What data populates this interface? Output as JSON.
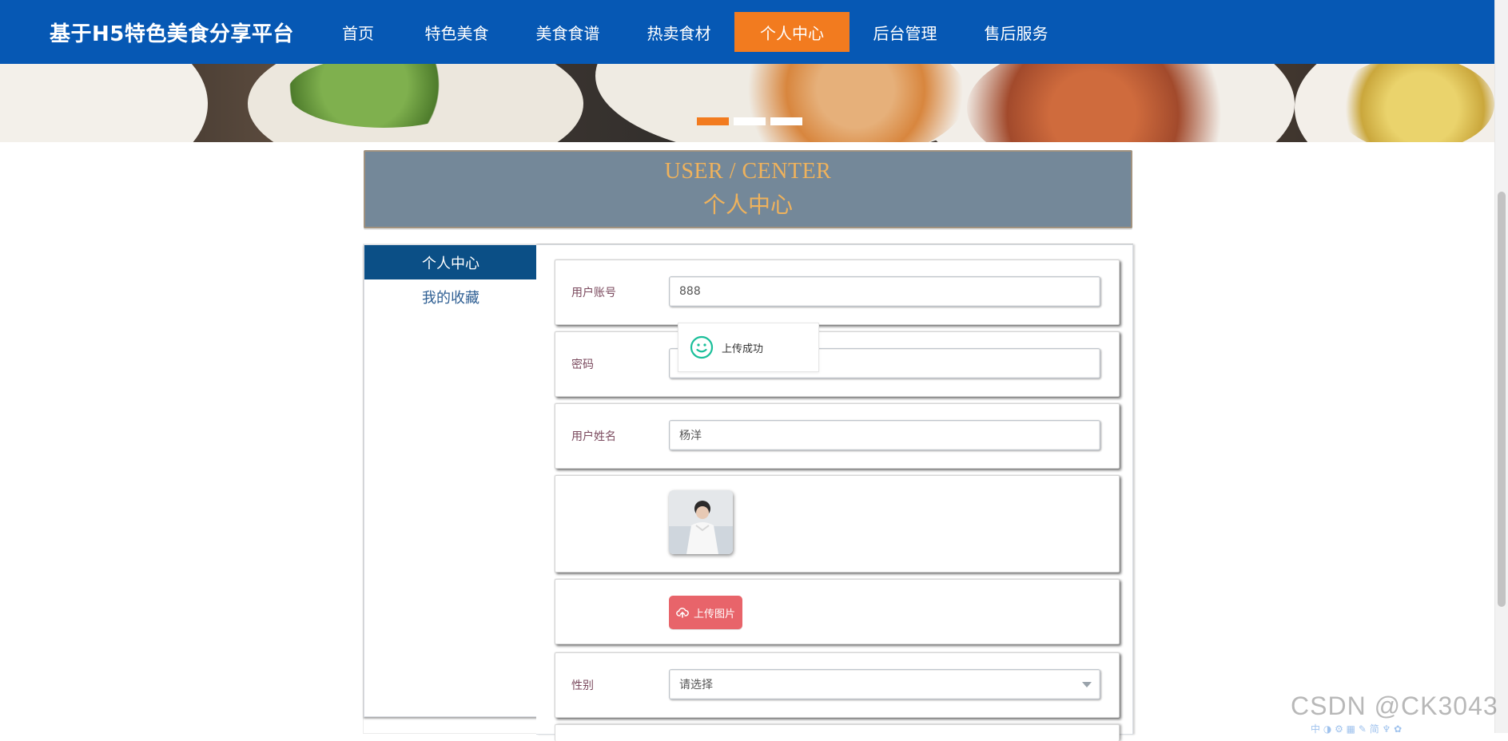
{
  "nav": {
    "brand": "基于H5特色美食分享平台",
    "items": [
      {
        "label": "首页",
        "active": false
      },
      {
        "label": "特色美食",
        "active": false
      },
      {
        "label": "美食食谱",
        "active": false
      },
      {
        "label": "热卖食材",
        "active": false
      },
      {
        "label": "个人中心",
        "active": true
      },
      {
        "label": "后台管理",
        "active": false
      },
      {
        "label": "售后服务",
        "active": false
      }
    ]
  },
  "hero": {
    "carousel": {
      "active_index": 0,
      "dots": 3
    }
  },
  "banner": {
    "title_en": "USER / CENTER",
    "title_cn": "个人中心"
  },
  "sidebar": {
    "items": [
      {
        "label": "个人中心",
        "active": true
      },
      {
        "label": "我的收藏",
        "active": false
      }
    ]
  },
  "form": {
    "account_label": "用户账号",
    "account_value": "888",
    "password_label": "密码",
    "password_value": "",
    "name_label": "用户姓名",
    "name_value": "杨洋",
    "upload_button": "上传图片",
    "gender_label": "性别",
    "gender_placeholder": "请选择"
  },
  "toast": {
    "message": "上传成功"
  },
  "watermark": {
    "text": "CSDN @CK3043"
  },
  "tray": {
    "text": "中 ◑ ⚙ ▦ ✎ 简 ♆ ✿"
  },
  "colors": {
    "nav": "#0658b4",
    "nav_active": "#f27b1f",
    "banner_bg": "#748899",
    "banner_text": "#efb25c",
    "upload": "#e8646a"
  }
}
